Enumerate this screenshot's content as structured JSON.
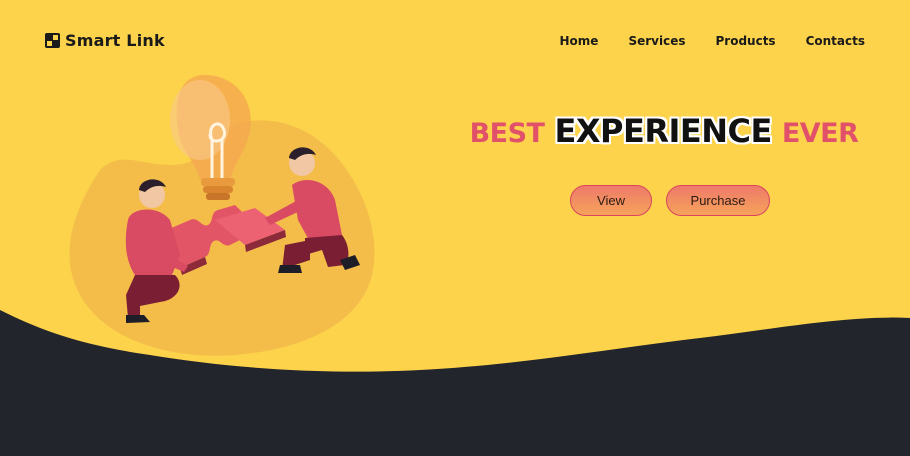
{
  "brand": {
    "name": "Smart Link",
    "icon": "checkered-square-icon"
  },
  "nav": {
    "items": [
      {
        "label": "Home"
      },
      {
        "label": "Services"
      },
      {
        "label": "Products"
      },
      {
        "label": "Contacts"
      }
    ]
  },
  "hero": {
    "headline_left": "Best",
    "headline_main": "Experience",
    "headline_right": "Ever",
    "buttons": [
      {
        "label": "View"
      },
      {
        "label": "Purchase"
      }
    ]
  },
  "colors": {
    "background": "#fcd34b",
    "wave": "#23252c",
    "accent": "#e2516a",
    "button_gradient_start": "#ee7a6a",
    "button_gradient_end": "#f6a35a"
  }
}
